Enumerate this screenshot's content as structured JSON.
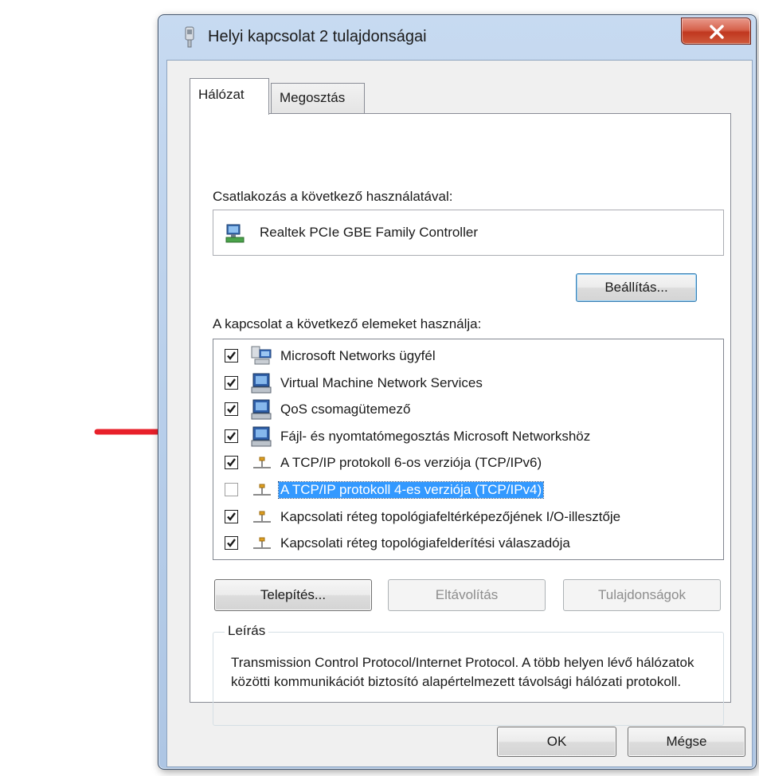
{
  "window": {
    "title": "Helyi kapcsolat 2 tulajdonságai",
    "close_glyph": "x"
  },
  "tabs": [
    {
      "label": "Hálózat",
      "active": true
    },
    {
      "label": "Megosztás",
      "active": false
    }
  ],
  "connect_using": {
    "label": "Csatlakozás a következő használatával:",
    "adapter": "Realtek PCIe GBE Family Controller",
    "adapter_icon": "network-adapter-icon"
  },
  "configure_button": "Beállítás...",
  "items_label": "A kapcsolat a következő elemeket használja:",
  "items": [
    {
      "label": "Microsoft Networks ügyfél",
      "checked": true,
      "selected": false,
      "icon": "network-client-icon"
    },
    {
      "label": "Virtual Machine Network Services",
      "checked": true,
      "selected": false,
      "icon": "network-service-icon"
    },
    {
      "label": "QoS csomagütemező",
      "checked": true,
      "selected": false,
      "icon": "network-service-icon"
    },
    {
      "label": "Fájl- és nyomtatómegosztás Microsoft Networkshöz",
      "checked": true,
      "selected": false,
      "icon": "network-service-icon"
    },
    {
      "label": "A TCP/IP protokoll 6-os verziója (TCP/IPv6)",
      "checked": true,
      "selected": false,
      "icon": "protocol-icon"
    },
    {
      "label": "A TCP/IP protokoll 4-es verziója (TCP/IPv4)",
      "checked": false,
      "selected": true,
      "icon": "protocol-icon"
    },
    {
      "label": "Kapcsolati réteg topológiafeltérképezőjének I/O-illesztője",
      "checked": true,
      "selected": false,
      "icon": "protocol-icon"
    },
    {
      "label": "Kapcsolati réteg topológiafelderítési válaszadója",
      "checked": true,
      "selected": false,
      "icon": "protocol-icon"
    }
  ],
  "buttons": {
    "install": "Telepítés...",
    "uninstall": "Eltávolítás",
    "properties": "Tulajdonságok",
    "ok": "OK",
    "cancel": "Mégse"
  },
  "description": {
    "legend": "Leírás",
    "text": "Transmission Control Protocol/Internet Protocol. A több helyen lévő hálózatok közötti kommunikációt biztosító alapértelmezett távolsági hálózati protokoll."
  },
  "colors": {
    "selection": "#3399ff",
    "annotation_arrow": "#e8202a",
    "close_button": "#c7402a"
  }
}
